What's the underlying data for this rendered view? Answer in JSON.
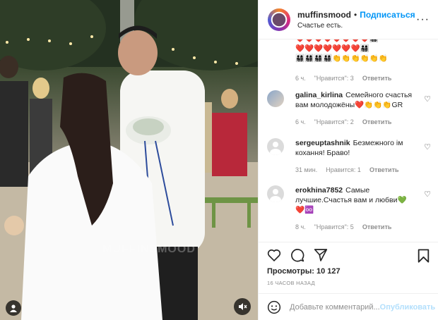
{
  "header": {
    "username": "muffinsmood",
    "separator": "•",
    "follow_label": "Подписаться",
    "caption": "Счастье есть.",
    "more_label": "···"
  },
  "media": {
    "watermark": "MUFFINSMOOD",
    "user_icon": "person-icon",
    "mute_icon": "speaker-muted-icon"
  },
  "comments": [
    {
      "username": "",
      "text_lines": [
        "❤️❤️❤️❤️❤️❤️❤️❤️👨‍👩‍👧‍👦",
        "❤️❤️❤️❤️❤️❤️❤️👨‍👩‍👧‍👦",
        "👨‍👩‍👧‍👦👨‍👩‍👧‍👦👨‍👩‍👧‍👦👨‍👩‍👧‍👦👏👏👏👏👏👏"
      ],
      "time": "6 ч.",
      "likes": "\"Нравится\": 3",
      "reply": "Ответить"
    },
    {
      "username": "galina_kirlina",
      "text": "Семейного счастья вам молодожёны❤️👏👏👏GR",
      "time": "6 ч.",
      "likes": "\"Нравится\": 2",
      "reply": "Ответить"
    },
    {
      "username": "sergeuptashnik",
      "text": "Безмежного ім кохання! Браво!",
      "time": "31 мин.",
      "likes": "Нравится: 1",
      "reply": "Ответить"
    },
    {
      "username": "erokhina7852",
      "text": "Самые лучшие.Счастья вам и любви💚 ❤️♾️",
      "time": "8 ч.",
      "likes": "\"Нравится\": 5",
      "reply": "Ответить"
    }
  ],
  "actions": {
    "like_icon": "heart-icon",
    "comment_icon": "comment-icon",
    "share_icon": "share-icon",
    "save_icon": "bookmark-icon"
  },
  "views_label": "Просмотры:",
  "views_count": "10 127",
  "posted_ago": "16 ЧАСОВ НАЗАД",
  "add_comment": {
    "placeholder": "Добавьте комментарий...",
    "publish_label": "Опубликовать"
  }
}
